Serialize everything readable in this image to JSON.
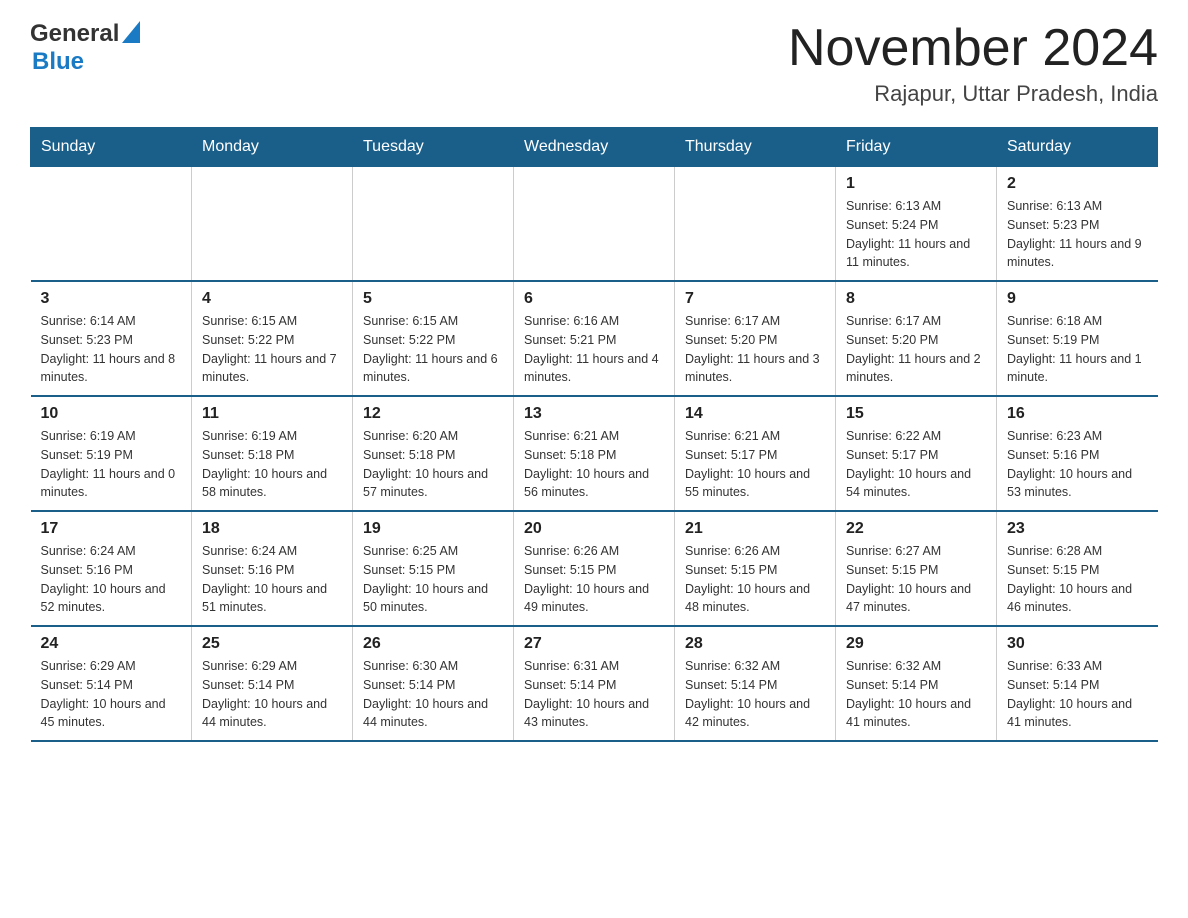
{
  "header": {
    "logo_general": "General",
    "logo_blue": "Blue",
    "month_year": "November 2024",
    "location": "Rajapur, Uttar Pradesh, India"
  },
  "weekdays": [
    "Sunday",
    "Monday",
    "Tuesday",
    "Wednesday",
    "Thursday",
    "Friday",
    "Saturday"
  ],
  "weeks": [
    [
      {
        "day": "",
        "sunrise": "",
        "sunset": "",
        "daylight": ""
      },
      {
        "day": "",
        "sunrise": "",
        "sunset": "",
        "daylight": ""
      },
      {
        "day": "",
        "sunrise": "",
        "sunset": "",
        "daylight": ""
      },
      {
        "day": "",
        "sunrise": "",
        "sunset": "",
        "daylight": ""
      },
      {
        "day": "",
        "sunrise": "",
        "sunset": "",
        "daylight": ""
      },
      {
        "day": "1",
        "sunrise": "Sunrise: 6:13 AM",
        "sunset": "Sunset: 5:24 PM",
        "daylight": "Daylight: 11 hours and 11 minutes."
      },
      {
        "day": "2",
        "sunrise": "Sunrise: 6:13 AM",
        "sunset": "Sunset: 5:23 PM",
        "daylight": "Daylight: 11 hours and 9 minutes."
      }
    ],
    [
      {
        "day": "3",
        "sunrise": "Sunrise: 6:14 AM",
        "sunset": "Sunset: 5:23 PM",
        "daylight": "Daylight: 11 hours and 8 minutes."
      },
      {
        "day": "4",
        "sunrise": "Sunrise: 6:15 AM",
        "sunset": "Sunset: 5:22 PM",
        "daylight": "Daylight: 11 hours and 7 minutes."
      },
      {
        "day": "5",
        "sunrise": "Sunrise: 6:15 AM",
        "sunset": "Sunset: 5:22 PM",
        "daylight": "Daylight: 11 hours and 6 minutes."
      },
      {
        "day": "6",
        "sunrise": "Sunrise: 6:16 AM",
        "sunset": "Sunset: 5:21 PM",
        "daylight": "Daylight: 11 hours and 4 minutes."
      },
      {
        "day": "7",
        "sunrise": "Sunrise: 6:17 AM",
        "sunset": "Sunset: 5:20 PM",
        "daylight": "Daylight: 11 hours and 3 minutes."
      },
      {
        "day": "8",
        "sunrise": "Sunrise: 6:17 AM",
        "sunset": "Sunset: 5:20 PM",
        "daylight": "Daylight: 11 hours and 2 minutes."
      },
      {
        "day": "9",
        "sunrise": "Sunrise: 6:18 AM",
        "sunset": "Sunset: 5:19 PM",
        "daylight": "Daylight: 11 hours and 1 minute."
      }
    ],
    [
      {
        "day": "10",
        "sunrise": "Sunrise: 6:19 AM",
        "sunset": "Sunset: 5:19 PM",
        "daylight": "Daylight: 11 hours and 0 minutes."
      },
      {
        "day": "11",
        "sunrise": "Sunrise: 6:19 AM",
        "sunset": "Sunset: 5:18 PM",
        "daylight": "Daylight: 10 hours and 58 minutes."
      },
      {
        "day": "12",
        "sunrise": "Sunrise: 6:20 AM",
        "sunset": "Sunset: 5:18 PM",
        "daylight": "Daylight: 10 hours and 57 minutes."
      },
      {
        "day": "13",
        "sunrise": "Sunrise: 6:21 AM",
        "sunset": "Sunset: 5:18 PM",
        "daylight": "Daylight: 10 hours and 56 minutes."
      },
      {
        "day": "14",
        "sunrise": "Sunrise: 6:21 AM",
        "sunset": "Sunset: 5:17 PM",
        "daylight": "Daylight: 10 hours and 55 minutes."
      },
      {
        "day": "15",
        "sunrise": "Sunrise: 6:22 AM",
        "sunset": "Sunset: 5:17 PM",
        "daylight": "Daylight: 10 hours and 54 minutes."
      },
      {
        "day": "16",
        "sunrise": "Sunrise: 6:23 AM",
        "sunset": "Sunset: 5:16 PM",
        "daylight": "Daylight: 10 hours and 53 minutes."
      }
    ],
    [
      {
        "day": "17",
        "sunrise": "Sunrise: 6:24 AM",
        "sunset": "Sunset: 5:16 PM",
        "daylight": "Daylight: 10 hours and 52 minutes."
      },
      {
        "day": "18",
        "sunrise": "Sunrise: 6:24 AM",
        "sunset": "Sunset: 5:16 PM",
        "daylight": "Daylight: 10 hours and 51 minutes."
      },
      {
        "day": "19",
        "sunrise": "Sunrise: 6:25 AM",
        "sunset": "Sunset: 5:15 PM",
        "daylight": "Daylight: 10 hours and 50 minutes."
      },
      {
        "day": "20",
        "sunrise": "Sunrise: 6:26 AM",
        "sunset": "Sunset: 5:15 PM",
        "daylight": "Daylight: 10 hours and 49 minutes."
      },
      {
        "day": "21",
        "sunrise": "Sunrise: 6:26 AM",
        "sunset": "Sunset: 5:15 PM",
        "daylight": "Daylight: 10 hours and 48 minutes."
      },
      {
        "day": "22",
        "sunrise": "Sunrise: 6:27 AM",
        "sunset": "Sunset: 5:15 PM",
        "daylight": "Daylight: 10 hours and 47 minutes."
      },
      {
        "day": "23",
        "sunrise": "Sunrise: 6:28 AM",
        "sunset": "Sunset: 5:15 PM",
        "daylight": "Daylight: 10 hours and 46 minutes."
      }
    ],
    [
      {
        "day": "24",
        "sunrise": "Sunrise: 6:29 AM",
        "sunset": "Sunset: 5:14 PM",
        "daylight": "Daylight: 10 hours and 45 minutes."
      },
      {
        "day": "25",
        "sunrise": "Sunrise: 6:29 AM",
        "sunset": "Sunset: 5:14 PM",
        "daylight": "Daylight: 10 hours and 44 minutes."
      },
      {
        "day": "26",
        "sunrise": "Sunrise: 6:30 AM",
        "sunset": "Sunset: 5:14 PM",
        "daylight": "Daylight: 10 hours and 44 minutes."
      },
      {
        "day": "27",
        "sunrise": "Sunrise: 6:31 AM",
        "sunset": "Sunset: 5:14 PM",
        "daylight": "Daylight: 10 hours and 43 minutes."
      },
      {
        "day": "28",
        "sunrise": "Sunrise: 6:32 AM",
        "sunset": "Sunset: 5:14 PM",
        "daylight": "Daylight: 10 hours and 42 minutes."
      },
      {
        "day": "29",
        "sunrise": "Sunrise: 6:32 AM",
        "sunset": "Sunset: 5:14 PM",
        "daylight": "Daylight: 10 hours and 41 minutes."
      },
      {
        "day": "30",
        "sunrise": "Sunrise: 6:33 AM",
        "sunset": "Sunset: 5:14 PM",
        "daylight": "Daylight: 10 hours and 41 minutes."
      }
    ]
  ]
}
